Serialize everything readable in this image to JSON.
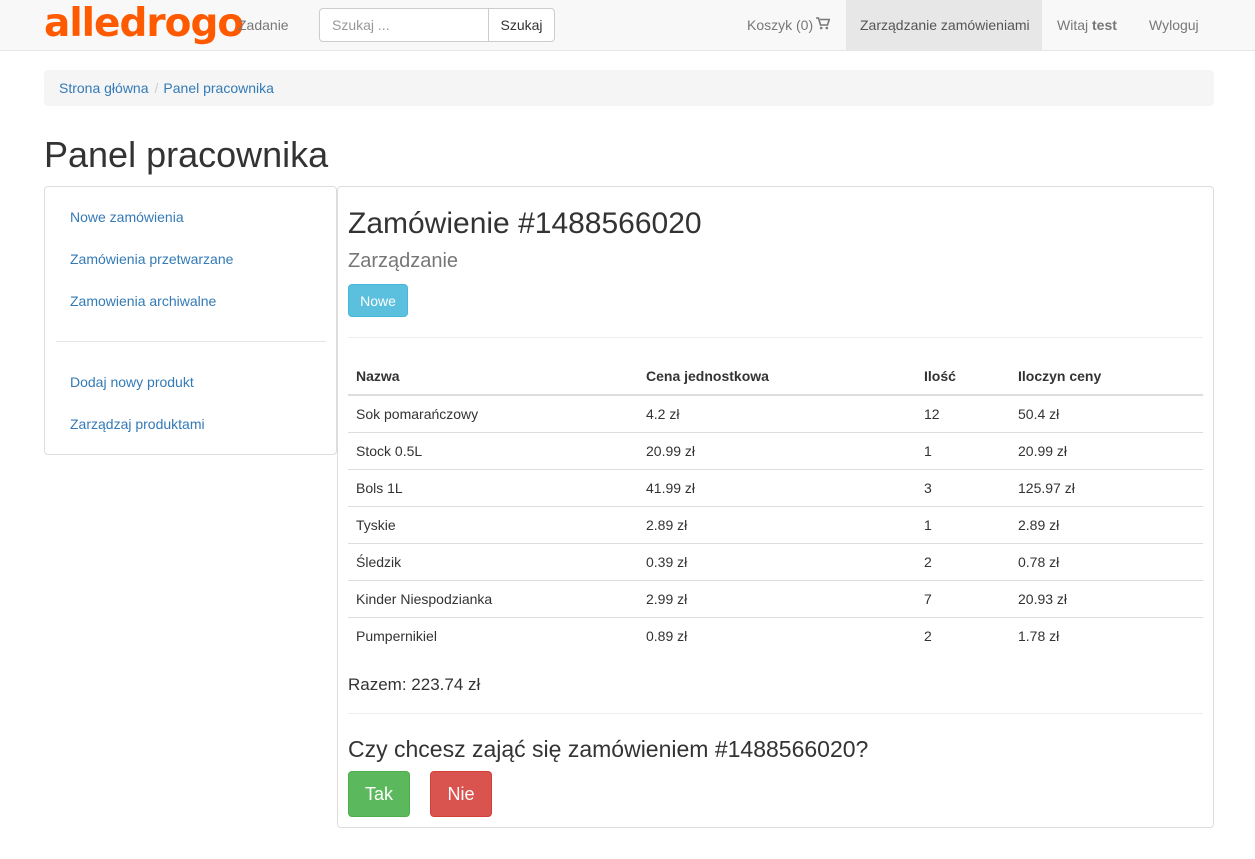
{
  "navbar": {
    "brand": "alledrogo",
    "task_link": "Zadanie",
    "search_placeholder": "Szukaj ...",
    "search_button": "Szukaj",
    "cart_label": "Koszyk (0)",
    "cart_icon": "shopping-cart-icon",
    "orders_management": "Zarządzanie zamówieniami",
    "welcome_prefix": "Witaj",
    "username": "test",
    "logout": "Wyloguj"
  },
  "breadcrumb": {
    "home": "Strona główna",
    "separator": "/",
    "current": "Panel pracownika"
  },
  "page_title": "Panel pracownika",
  "sidebar": {
    "items": [
      {
        "label": "Nowe zamówienia"
      },
      {
        "label": "Zamówienia przetwarzane"
      },
      {
        "label": "Zamowienia archiwalne"
      },
      {
        "label": "Dodaj nowy produkt"
      },
      {
        "label": "Zarządzaj produktami"
      }
    ]
  },
  "order": {
    "title": "Zamówienie #1488566020",
    "subtitle": "Zarządzanie",
    "status_button": "Nowe",
    "columns": [
      "Nazwa",
      "Cena jednostkowa",
      "Ilość",
      "Iloczyn ceny"
    ],
    "rows": [
      [
        "Sok pomarańczowy",
        "4.2 zł",
        "12",
        "50.4 zł"
      ],
      [
        "Stock 0.5L",
        "20.99 zł",
        "1",
        "20.99 zł"
      ],
      [
        "Bols 1L",
        "41.99 zł",
        "3",
        "125.97 zł"
      ],
      [
        "Tyskie",
        "2.89 zł",
        "1",
        "2.89 zł"
      ],
      [
        "Śledzik",
        "0.39 zł",
        "2",
        "0.78 zł"
      ],
      [
        "Kinder Niespodzianka",
        "2.99 zł",
        "7",
        "20.93 zł"
      ],
      [
        "Pumpernikiel",
        "0.89 zł",
        "2",
        "1.78 zł"
      ]
    ],
    "total": "Razem: 223.74 zł",
    "question": "Czy chcesz zająć się zamówieniem #1488566020?",
    "yes_button": "Tak",
    "no_button": "Nie"
  },
  "colors": {
    "brand": "#ff5a00",
    "link": "#337ab7",
    "info": "#5bc0de",
    "success": "#5cb85c",
    "danger": "#d9534f"
  }
}
